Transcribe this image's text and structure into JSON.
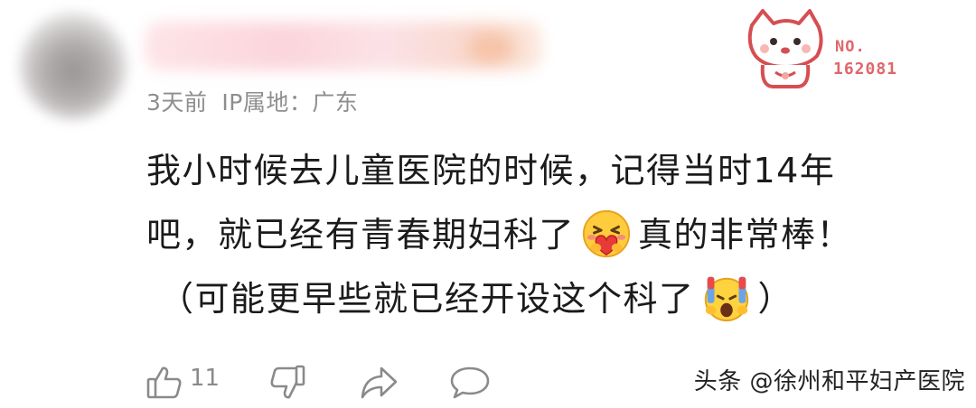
{
  "comment": {
    "meta": {
      "time": "3天前",
      "ip_location": "IP属地：广东"
    },
    "badge": {
      "label": "NO.",
      "number": "162081"
    },
    "text": {
      "line1": "我小时候去儿童医院的时候，记得当时14年",
      "line2_before": "吧，就已经有青春期妇科了",
      "line2_after": "真的非常棒！",
      "line3_before": "（可能更早些就已经开设这个科了",
      "line3_after": "）"
    },
    "emojis": {
      "inline_1": "hugging-heart-emoji",
      "inline_2": "shocked-face-emoji"
    },
    "actions": {
      "like_icon": "thumbs-up-icon",
      "like_count": "11",
      "dislike_icon": "thumbs-down-icon",
      "share_icon": "share-arrow-icon",
      "reply_icon": "comment-bubble-icon"
    }
  },
  "watermark": "头条 @徐州和平妇产医院"
}
